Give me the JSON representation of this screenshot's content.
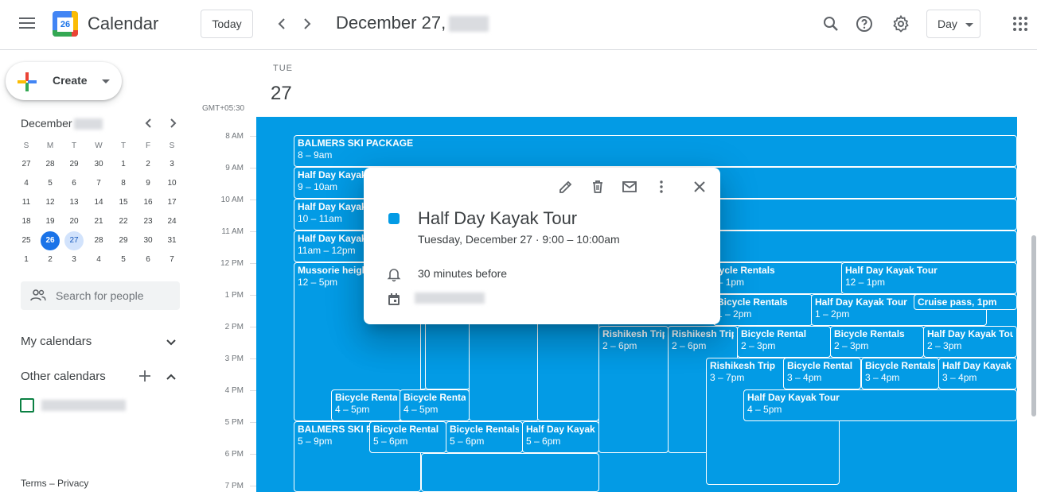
{
  "header": {
    "app_name": "Calendar",
    "logo_day": "26",
    "today_label": "Today",
    "date_title": "December 27,",
    "view_label": "Day"
  },
  "sidebar": {
    "create_label": "Create",
    "mini_month": "December",
    "dow": [
      "S",
      "M",
      "T",
      "W",
      "T",
      "F",
      "S"
    ],
    "weeks": [
      [
        "27",
        "28",
        "29",
        "30",
        "1",
        "2",
        "3"
      ],
      [
        "4",
        "5",
        "6",
        "7",
        "8",
        "9",
        "10"
      ],
      [
        "11",
        "12",
        "13",
        "14",
        "15",
        "16",
        "17"
      ],
      [
        "18",
        "19",
        "20",
        "21",
        "22",
        "23",
        "24"
      ],
      [
        "25",
        "26",
        "27",
        "28",
        "29",
        "30",
        "31"
      ],
      [
        "1",
        "2",
        "3",
        "4",
        "5",
        "6",
        "7"
      ]
    ],
    "search_placeholder": "Search for people",
    "my_calendars": "My calendars",
    "other_calendars": "Other calendars",
    "footer_terms": "Terms",
    "footer_sep": "–",
    "footer_privacy": "Privacy"
  },
  "day_view": {
    "dow": "TUE",
    "dom": "27",
    "timezone": "GMT+05:30",
    "hours": [
      "8 AM",
      "9 AM",
      "10 AM",
      "11 AM",
      "12 PM",
      "1 PM",
      "2 PM",
      "3 PM",
      "4 PM",
      "5 PM",
      "6 PM",
      "7 PM"
    ]
  },
  "events": [
    {
      "title": "BALMERS SKI PACKAGE",
      "time": "8 – 9am"
    },
    {
      "title": "Half Day Kayak Tour",
      "time": "9 – 10am"
    },
    {
      "title": "Half Day Kayak Tour",
      "time": "10 – 11am"
    },
    {
      "title": "Half Day Kayak Tour",
      "time": "11am – 12pm"
    },
    {
      "title": "Mussorie heights",
      "time": "12 – 5pm"
    },
    {
      "title": "Bicycle Rentals",
      "time": "12 – 1pm"
    },
    {
      "title": "Half Day Kayak Tour",
      "time": "12 – 1pm"
    },
    {
      "title": "Bicycle Rentals",
      "time": "1 – 2pm"
    },
    {
      "title": "Half Day Kayak Tour",
      "time": "1 – 2pm"
    },
    {
      "title": "Cruise pass, 1pm",
      "time": ""
    },
    {
      "title": "Rishikesh Trip",
      "time": "2 – 6pm"
    },
    {
      "title": "Rishikesh Trip",
      "time": "2 – 6pm"
    },
    {
      "title": "Bicycle Rental",
      "time": "2 – 3pm"
    },
    {
      "title": "Bicycle Rentals",
      "time": "2 – 3pm"
    },
    {
      "title": "Half Day Kayak Tour",
      "time": "2 – 3pm"
    },
    {
      "title": "Rishikesh Trip",
      "time": "3 – 7pm"
    },
    {
      "title": "Bicycle Rental",
      "time": "3 – 4pm"
    },
    {
      "title": "Bicycle Rentals",
      "time": "3 – 4pm"
    },
    {
      "title": "Half Day Kayak Tour",
      "time": "3 – 4pm"
    },
    {
      "title": "Bicycle Rental",
      "time": "4 – 5pm"
    },
    {
      "title": "Bicycle Rentals",
      "time": "4 – 5pm"
    },
    {
      "title": "Half Day Kayak Tour",
      "time": "4 – 5pm"
    },
    {
      "title": "BALMERS SKI PACKAGE",
      "time": "5 – 9pm"
    },
    {
      "title": "Bicycle Rental",
      "time": "5 – 6pm"
    },
    {
      "title": "Bicycle Rentals",
      "time": "5 – 6pm"
    },
    {
      "title": "Half Day Kayak Tour",
      "time": "5 – 6pm"
    }
  ],
  "popup": {
    "title": "Half Day Kayak Tour",
    "when": "Tuesday, December 27  ·  9:00 – 10:00am",
    "reminder": "30 minutes before",
    "event_color": "#039be5"
  },
  "colors": {
    "event_blue": "#039be5",
    "accent": "#1a73e8"
  }
}
